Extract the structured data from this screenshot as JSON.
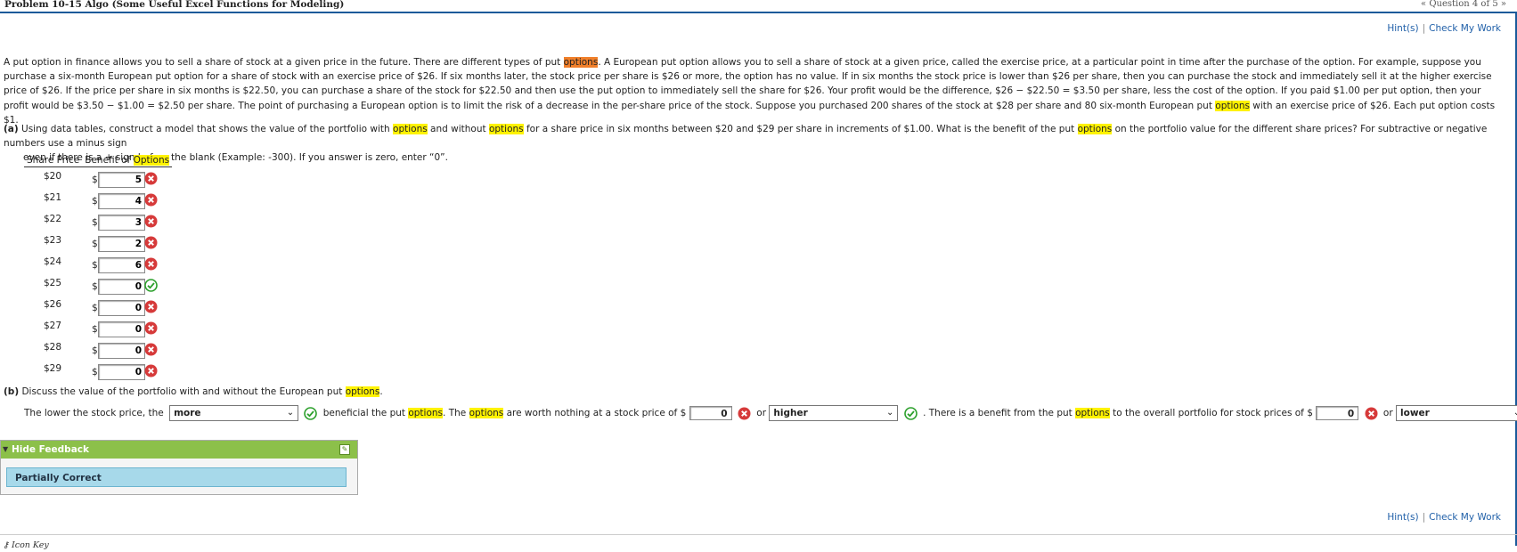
{
  "header": {
    "title": "Problem 10-15 Algo (Some Useful Excel Functions for Modeling)",
    "question_nav": "« Question 4 of 5 »"
  },
  "hints": {
    "hint_label": "Hint(s)",
    "check_label": "Check My Work"
  },
  "intro": {
    "s1": "A put option in finance allows you to sell a share of stock at a given price in the future. There are different types of put ",
    "s1_hl": "options",
    "s2": ". A European put option allows you to sell a share of stock at a given price, called the exercise price, at a particular point in time after the purchase of the option. For example, suppose you purchase a six-month European put option for a share of stock with an exercise price of $26. If six months later, the stock price per share is $26 or more, the option has no value. If in six months the stock price is lower than $26 per share, then you can purchase the stock and immediately sell it at the higher exercise price of $26. If the price per share in six months is $22.50, you can purchase a share of the stock for $22.50 and then use the put option to immediately sell the share for $26. Your profit would be the difference, $26 − $22.50 = $3.50 per share, less the cost of the option. If you paid $1.00 per put option, then your profit would be $3.50 − $1.00 = $2.50 per share. The point of purchasing a European option is to limit the risk of a decrease in the per-share price of the stock. Suppose you purchased 200 shares of the stock at $28 per share and 80 six-month European put ",
    "s2_hl": "options",
    "s3": " with an exercise price of $26. Each put option costs $1."
  },
  "part_a": {
    "label": "(a)",
    "t1": " Using data tables, construct a model that shows the value of the portfolio with ",
    "hl1": "options",
    "t2": " and without ",
    "hl2": "options",
    "t3": " for a share price in six months between $20 and $29 per share in increments of $1.00. What is the benefit of the put ",
    "hl3": "options",
    "t4": " on the portfolio value for the different share prices? For subtractive or negative numbers use a minus sign",
    "t5": "even if there is a + sign before the blank (Example: -300). If you answer is zero, enter “0”.",
    "col_price": "Share Price",
    "col_benefit_pre": "Benefit of ",
    "col_benefit_hl": "Options",
    "rows": [
      {
        "price": "$20",
        "currency": "$",
        "value": "5",
        "status": "wrong"
      },
      {
        "price": "$21",
        "currency": "$",
        "value": "4",
        "status": "wrong"
      },
      {
        "price": "$22",
        "currency": "$",
        "value": "3",
        "status": "wrong"
      },
      {
        "price": "$23",
        "currency": "$",
        "value": "2",
        "status": "wrong"
      },
      {
        "price": "$24",
        "currency": "$",
        "value": "6",
        "status": "wrong"
      },
      {
        "price": "$25",
        "currency": "$",
        "value": "0",
        "status": "correct"
      },
      {
        "price": "$26",
        "currency": "$",
        "value": "0",
        "status": "wrong"
      },
      {
        "price": "$27",
        "currency": "$",
        "value": "0",
        "status": "wrong"
      },
      {
        "price": "$28",
        "currency": "$",
        "value": "0",
        "status": "wrong"
      },
      {
        "price": "$29",
        "currency": "$",
        "value": "0",
        "status": "wrong"
      }
    ]
  },
  "part_b": {
    "label": "(b)",
    "q1": " Discuss the value of the portfolio with and without the European put ",
    "q1_hl": "options",
    "q1_end": ".",
    "s_a": "The lower the stock price, the",
    "select1": "more",
    "s_b": "beneficial the put ",
    "s_b_hl": "options",
    "s_c": ". The ",
    "s_c_hl": "options",
    "s_d": " are worth nothing at a stock price of $",
    "input1": "0",
    "s_e": "or",
    "select2": "higher",
    "s_f": ". There is a benefit from the put ",
    "s_f_hl": "options",
    "s_g": " to the overall portfolio for stock prices of $",
    "input2": "0",
    "s_h": "or",
    "select3": "lower",
    "s_i": "."
  },
  "feedback": {
    "toggle_label": "Hide Feedback",
    "result": "Partially Correct"
  },
  "footer": {
    "icon_key": "Icon Key"
  },
  "colors": {
    "correct": "#2ca02c",
    "wrong": "#d63a3a",
    "highlight": "#fff200",
    "accent": "#1f5fa8"
  }
}
